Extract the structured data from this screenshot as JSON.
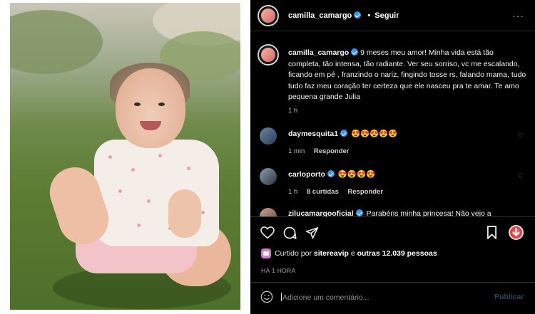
{
  "post_author": {
    "username": "camilla_camargo",
    "follow_label": "Seguir",
    "separator": "•"
  },
  "caption": {
    "username": "camilla_camargo",
    "text": "9 meses meu amor! Minha vida está tão completa, tão intensa, tão radiante. Ver seu sorriso, vc me escalando, ficando em pé , franzindo o nariz, fingindo tosse rs, falando mama, tudo tudo faz meu coração ter certeza que ele nasceu pra te amar. Te amo pequena grande Julia",
    "time": "1 h"
  },
  "comments": [
    {
      "username": "daymesquita1",
      "text": "😍😍😍😍😍",
      "time": "1 min",
      "reply_label": "Responder",
      "likes_label": ""
    },
    {
      "username": "carloporto",
      "text": "😍😍😍😍",
      "time": "1 h",
      "likes_label": "8 curtidas",
      "reply_label": "Responder"
    },
    {
      "username": "zilucamargooficial",
      "text": "Parabéns minha princesa! Não vejo a"
    }
  ],
  "actions": {
    "like_icon": "heart-icon",
    "comment_icon": "comment-icon",
    "share_icon": "share-icon",
    "save_icon": "bookmark-icon"
  },
  "likes": {
    "prefix": "Curtido por",
    "user": "sitereavip",
    "conjunction": "e",
    "others": "outras 12.039 pessoas"
  },
  "timestamp": "HÁ 1 HORA",
  "comment_box": {
    "placeholder": "Adicione um comentário...",
    "publish_label": "Publicar"
  },
  "colors": {
    "panel_bg": "#000000",
    "verified": "#3897f0",
    "publish": "#1e4a6a"
  }
}
